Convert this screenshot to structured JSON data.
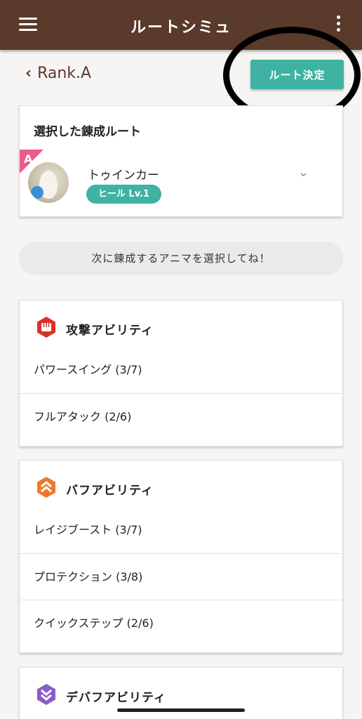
{
  "appbar": {
    "title": "ルートシミュ",
    "menu_icon": "hamburger-menu-icon",
    "more_icon": "kebab-more-icon"
  },
  "back": {
    "label": "Rank.A"
  },
  "decide_button": {
    "label": "ルート決定"
  },
  "route_card": {
    "heading": "選択した錬成ルート",
    "rank_badge": "A",
    "character": {
      "name": "トゥインカー",
      "skill": "ヒール Lv.1"
    },
    "expand_icon": "chevron-down-icon"
  },
  "hint": "次に錬成するアニマを選択してね！",
  "categories": [
    {
      "title": "攻撃アビリティ",
      "icon": "fist-attack-icon",
      "color": "#d9322a",
      "items": [
        "パワースイング (3/7)",
        "フルアタック (2/6)"
      ]
    },
    {
      "title": "バフアビリティ",
      "icon": "chevron-up-buff-icon",
      "color": "#ec7a2c",
      "items": [
        "レイジブースト (3/7)",
        "プロテクション (3/8)",
        "クイックステップ (2/6)"
      ]
    },
    {
      "title": "デバフアビリティ",
      "icon": "chevron-down-debuff-icon",
      "color": "#8a5cc8",
      "items": []
    }
  ],
  "colors": {
    "brand_brown": "#5a3a2a",
    "accent_teal": "#3fb3a3",
    "rank_pink": "#ec5a8f"
  }
}
